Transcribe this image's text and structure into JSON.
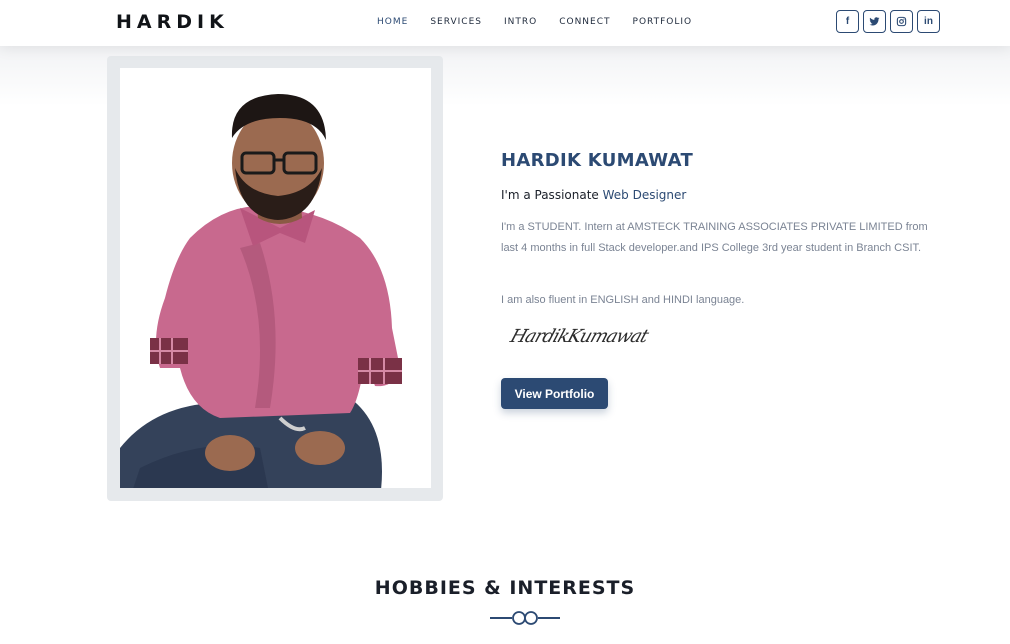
{
  "header": {
    "brand": "HARDIK",
    "nav": [
      "HOME",
      "SERVICES",
      "INTRO",
      "CONNECT",
      "PORTFOLIO"
    ],
    "social": [
      {
        "name": "facebook",
        "glyph": "f"
      },
      {
        "name": "twitter",
        "glyph": ""
      },
      {
        "name": "instagram",
        "glyph": ""
      },
      {
        "name": "linkedin",
        "glyph": "in"
      }
    ],
    "accent_color": "#2c4a73"
  },
  "about": {
    "name": "HARDIK KUMAWAT",
    "tagline_prefix": "I'm a Passionate ",
    "tagline_highlight": "Web Designer",
    "paragraph1": "I'm a STUDENT. Intern at AMSTECK TRAINING ASSOCIATES PRIVATE LIMITED from last 4 months in full Stack developer.and IPS College 3rd year student in Branch CSIT.",
    "paragraph2": "I am also fluent in ENGLISH and HINDI language.",
    "signature": "HardikKumawat",
    "button_label": "View Portfolio"
  },
  "hobbies": {
    "title": "HOBBIES & INTERESTS"
  }
}
